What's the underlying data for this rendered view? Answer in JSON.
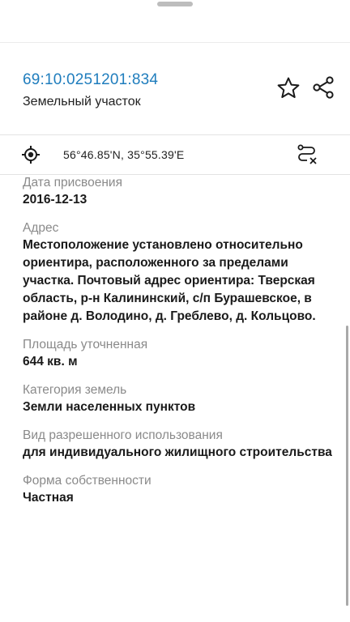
{
  "header": {
    "cadastral_number": "69:10:0251201:834",
    "object_type": "Земельный участок",
    "favorite_icon": "star-outline-icon",
    "share_icon": "share-icon"
  },
  "coordinates": {
    "text": "56°46.85'N, 35°55.39'E",
    "locate_icon": "target-icon",
    "route_icon": "route-cancel-icon"
  },
  "details": [
    {
      "label": "Дата присвоения",
      "value": "2016-12-13"
    },
    {
      "label": "Адрес",
      "value": "Местоположение установлено относительно ориентира, расположенного за пределами участка. Почтовый адрес ориентира: Тверская область, р-н Калининский, с/п Бурашевское, в районе д. Володино, д. Греблево, д. Кольцово."
    },
    {
      "label": "Площадь уточненная",
      "value": "644 кв. м"
    },
    {
      "label": "Категория земель",
      "value": "Земли населенных пунктов"
    },
    {
      "label": "Вид разрешенного использования",
      "value": "для индивидуального жилищного строительства"
    },
    {
      "label": "Форма собственности",
      "value": "Частная"
    }
  ],
  "colors": {
    "link": "#1f7dbd",
    "label": "#8a8a8a",
    "text": "#1a1a1a"
  }
}
